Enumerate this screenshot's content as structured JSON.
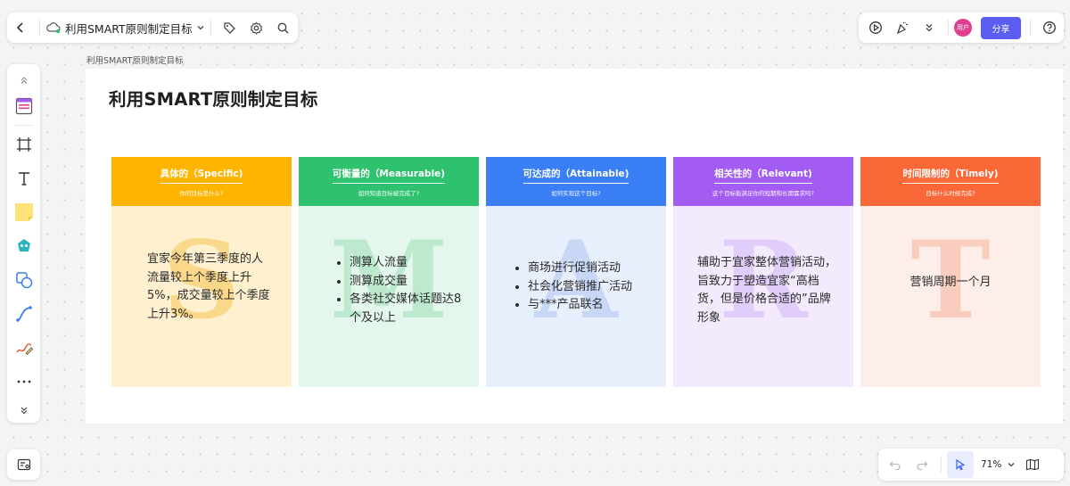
{
  "toolbar": {
    "doc_title": "利用SMART原则制定目标",
    "share_label": "分享",
    "avatar_label": "用户",
    "zoom": "71%"
  },
  "canvas": {
    "frame_label": "利用SMART原则制定目标",
    "title": "利用SMART原则制定目标"
  },
  "columns": [
    {
      "header": "具体的（Specific)",
      "sub": "你的目标是什么?",
      "letter": "S",
      "head_color": "#ffb400",
      "body_color": "#fff1cf",
      "letter_color": "#f9d88a",
      "text": "宜家今年第三季度的人流量较上个季度上升5%，成交量较上个季度上升3%。"
    },
    {
      "header": "可衡量的（Measurable)",
      "sub": "如何知道目标被完成了?",
      "letter": "M",
      "head_color": "#2ec26f",
      "body_color": "#e4f7ec",
      "letter_color": "#bde9cf",
      "items": [
        "测算人流量",
        "测算成交量",
        "各类社交媒体话题达8个及以上"
      ]
    },
    {
      "header": "可达成的（Attainable)",
      "sub": "如何实现这个目标?",
      "letter": "A",
      "head_color": "#3a7ff6",
      "body_color": "#e8effc",
      "letter_color": "#c8d7f6",
      "items": [
        "商场进行促销活动",
        "社会化营销推广活动",
        "与***产品联名"
      ]
    },
    {
      "header": "相关性的（Relevant)",
      "sub": "这个目标能满足你的短期和长期需求吗?",
      "letter": "R",
      "head_color": "#a35cf2",
      "body_color": "#f3ebfd",
      "letter_color": "#e0cdf9",
      "text": "辅助于宜家整体营销活动，旨致力于塑造宜家“高档货，但是价格合适的”品牌形象"
    },
    {
      "header": "时间限制的（Timely)",
      "sub": "目标什么时候完成?",
      "letter": "T",
      "head_color": "#fb6838",
      "body_color": "#fdeee9",
      "letter_color": "#f9cdbd",
      "text": "营销周期一个月"
    }
  ]
}
